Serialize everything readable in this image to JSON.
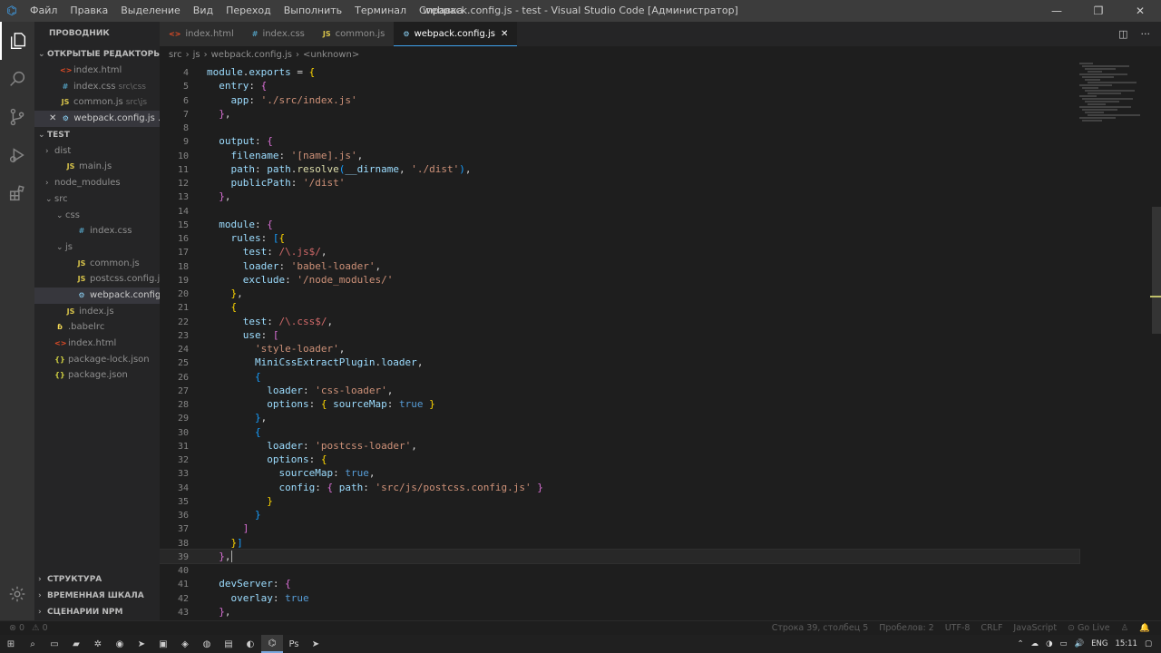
{
  "titlebar": {
    "logo_text": "⌬",
    "menu": [
      "Файл",
      "Правка",
      "Выделение",
      "Вид",
      "Переход",
      "Выполнить",
      "Терминал",
      "Справка"
    ],
    "window_title": "webpack.config.js - test - Visual Studio Code [Администратор]",
    "controls": [
      "—",
      "❐",
      "✕"
    ]
  },
  "sidebar": {
    "title": "ПРОВОДНИК",
    "open_editors_title": "ОТКРЫТЫЕ РЕДАКТОРЫ",
    "open_editors": [
      {
        "icon": "<>",
        "icon_class": "ic-html",
        "name": "index.html",
        "path": ""
      },
      {
        "icon": "#",
        "icon_class": "ic-css",
        "name": "index.css",
        "path": "src\\css"
      },
      {
        "icon": "JS",
        "icon_class": "ic-js",
        "name": "common.js",
        "path": "src\\js"
      },
      {
        "icon": "⚙",
        "icon_class": "ic-wp",
        "name": "webpack.config.js ...",
        "path": "",
        "close": "✕"
      }
    ],
    "project_title": "TEST",
    "tree": [
      {
        "indent": 1,
        "chev": "›",
        "icon": "",
        "icon_class": "",
        "name": "dist"
      },
      {
        "indent": 2,
        "chev": "",
        "icon": "JS",
        "icon_class": "ic-js",
        "name": "main.js"
      },
      {
        "indent": 1,
        "chev": "›",
        "icon": "",
        "icon_class": "",
        "name": "node_modules"
      },
      {
        "indent": 1,
        "chev": "⌄",
        "icon": "",
        "icon_class": "",
        "name": "src"
      },
      {
        "indent": 2,
        "chev": "⌄",
        "icon": "",
        "icon_class": "",
        "name": "css"
      },
      {
        "indent": 3,
        "chev": "",
        "icon": "#",
        "icon_class": "ic-css",
        "name": "index.css"
      },
      {
        "indent": 2,
        "chev": "⌄",
        "icon": "",
        "icon_class": "",
        "name": "js"
      },
      {
        "indent": 3,
        "chev": "",
        "icon": "JS",
        "icon_class": "ic-js",
        "name": "common.js"
      },
      {
        "indent": 3,
        "chev": "",
        "icon": "JS",
        "icon_class": "ic-js",
        "name": "postcss.config.js"
      },
      {
        "indent": 3,
        "chev": "",
        "icon": "⚙",
        "icon_class": "ic-wp",
        "name": "webpack.config.js",
        "selected": true
      },
      {
        "indent": 2,
        "chev": "",
        "icon": "JS",
        "icon_class": "ic-js",
        "name": "index.js"
      },
      {
        "indent": 1,
        "chev": "",
        "icon": "ɓ",
        "icon_class": "ic-babel",
        "name": ".babelrc"
      },
      {
        "indent": 1,
        "chev": "",
        "icon": "<>",
        "icon_class": "ic-html",
        "name": "index.html"
      },
      {
        "indent": 1,
        "chev": "",
        "icon": "{}",
        "icon_class": "ic-json",
        "name": "package-lock.json"
      },
      {
        "indent": 1,
        "chev": "",
        "icon": "{}",
        "icon_class": "ic-json",
        "name": "package.json"
      }
    ],
    "bottom_sections": [
      "СТРУКТУРА",
      "ВРЕМЕННАЯ ШКАЛА",
      "СЦЕНАРИИ NPM"
    ]
  },
  "tabs": [
    {
      "icon": "<>",
      "icon_class": "ic-html",
      "name": "index.html",
      "active": false
    },
    {
      "icon": "#",
      "icon_class": "ic-css",
      "name": "index.css",
      "active": false
    },
    {
      "icon": "JS",
      "icon_class": "ic-js",
      "name": "common.js",
      "active": false
    },
    {
      "icon": "⚙",
      "icon_class": "ic-wp",
      "name": "webpack.config.js",
      "active": true,
      "close": "✕"
    }
  ],
  "breadcrumb": {
    "items": [
      "src",
      "js",
      "webpack.config.js",
      "<unknown>"
    ],
    "separator": "›"
  },
  "editor": {
    "lines": [
      {
        "n": "4",
        "html": "<span class='k'>module</span><span class='p'>.</span><span class='k'>exports</span><span class='p'> = </span><span class='br1'>{</span>"
      },
      {
        "n": "5",
        "html": "  <span class='k'>entry</span><span class='p'>: </span><span class='br2'>{</span>"
      },
      {
        "n": "6",
        "html": "    <span class='k'>app</span><span class='p'>: </span><span class='s'>'./src/index.js'</span>"
      },
      {
        "n": "7",
        "html": "  <span class='br2'>}</span><span class='p'>,</span>"
      },
      {
        "n": "8",
        "html": ""
      },
      {
        "n": "9",
        "html": "  <span class='k'>output</span><span class='p'>: </span><span class='br2'>{</span>"
      },
      {
        "n": "10",
        "html": "    <span class='k'>filename</span><span class='p'>: </span><span class='s'>'[name].js'</span><span class='p'>,</span>"
      },
      {
        "n": "11",
        "html": "    <span class='k'>path</span><span class='p'>: </span><span class='k'>path</span><span class='p'>.</span><span class='f'>resolve</span><span class='br3'>(</span><span class='k'>__dirname</span><span class='p'>, </span><span class='s'>'./dist'</span><span class='br3'>)</span><span class='p'>,</span>"
      },
      {
        "n": "12",
        "html": "    <span class='k'>publicPath</span><span class='p'>: </span><span class='s'>'/dist'</span>"
      },
      {
        "n": "13",
        "html": "  <span class='br2'>}</span><span class='p'>,</span>"
      },
      {
        "n": "14",
        "html": ""
      },
      {
        "n": "15",
        "html": "  <span class='k'>module</span><span class='p'>: </span><span class='br2'>{</span>"
      },
      {
        "n": "16",
        "html": "    <span class='k'>rules</span><span class='p'>: </span><span class='br3'>[</span><span class='br1'>{</span>"
      },
      {
        "n": "17",
        "html": "      <span class='k'>test</span><span class='p'>: </span><span class='r'>/\\.js$/</span><span class='p'>,</span>"
      },
      {
        "n": "18",
        "html": "      <span class='k'>loader</span><span class='p'>: </span><span class='s'>'babel-loader'</span><span class='p'>,</span>"
      },
      {
        "n": "19",
        "html": "      <span class='k'>exclude</span><span class='p'>: </span><span class='s'>'/node_modules/'</span>"
      },
      {
        "n": "20",
        "html": "    <span class='br1'>}</span><span class='p'>,</span>"
      },
      {
        "n": "21",
        "html": "    <span class='br1'>{</span>"
      },
      {
        "n": "22",
        "html": "      <span class='k'>test</span><span class='p'>: </span><span class='r'>/\\.css$/</span><span class='p'>,</span>"
      },
      {
        "n": "23",
        "html": "      <span class='k'>use</span><span class='p'>: </span><span class='br2'>[</span>"
      },
      {
        "n": "24",
        "html": "        <span class='s'>'style-loader'</span><span class='p'>,</span>"
      },
      {
        "n": "25",
        "html": "        <span class='k'>MiniCssExtractPlugin</span><span class='p'>.</span><span class='k'>loader</span><span class='p'>,</span>"
      },
      {
        "n": "26",
        "html": "        <span class='br3'>{</span>"
      },
      {
        "n": "27",
        "html": "          <span class='k'>loader</span><span class='p'>: </span><span class='s'>'css-loader'</span><span class='p'>,</span>"
      },
      {
        "n": "28",
        "html": "          <span class='k'>options</span><span class='p'>: </span><span class='br1'>{</span><span class='p'> </span><span class='k'>sourceMap</span><span class='p'>: </span><span class='b'>true</span><span class='p'> </span><span class='br1'>}</span>"
      },
      {
        "n": "29",
        "html": "        <span class='br3'>}</span><span class='p'>,</span>"
      },
      {
        "n": "30",
        "html": "        <span class='br3'>{</span>"
      },
      {
        "n": "31",
        "html": "          <span class='k'>loader</span><span class='p'>: </span><span class='s'>'postcss-loader'</span><span class='p'>,</span>"
      },
      {
        "n": "32",
        "html": "          <span class='k'>options</span><span class='p'>: </span><span class='br1'>{</span>"
      },
      {
        "n": "33",
        "html": "            <span class='k'>sourceMap</span><span class='p'>: </span><span class='b'>true</span><span class='p'>,</span>"
      },
      {
        "n": "34",
        "html": "            <span class='k'>config</span><span class='p'>: </span><span class='br2'>{</span><span class='p'> </span><span class='k'>path</span><span class='p'>: </span><span class='s'>'src/js/postcss.config.js'</span><span class='p'> </span><span class='br2'>}</span>"
      },
      {
        "n": "35",
        "html": "          <span class='br1'>}</span>"
      },
      {
        "n": "36",
        "html": "        <span class='br3'>}</span>"
      },
      {
        "n": "37",
        "html": "      <span class='br2'>]</span>"
      },
      {
        "n": "38",
        "html": "    <span class='br1'>}</span><span class='br3'>]</span>"
      },
      {
        "n": "39",
        "html": "  <span class='br2'>}</span><span class='p'>,</span><span class='cursor'></span>",
        "current": true
      },
      {
        "n": "40",
        "html": ""
      },
      {
        "n": "41",
        "html": "  <span class='k'>devServer</span><span class='p'>: </span><span class='br2'>{</span>"
      },
      {
        "n": "42",
        "html": "    <span class='k'>overlay</span><span class='p'>: </span><span class='b'>true</span>"
      },
      {
        "n": "43",
        "html": "  <span class='br2'>}</span><span class='p'>,</span>"
      }
    ]
  },
  "statusbar": {
    "left": [
      "⊗ 0",
      "⚠ 0"
    ],
    "right": [
      "Строка 39, столбец 5",
      "Пробелов: 2",
      "UTF-8",
      "CRLF",
      "JavaScript",
      "⊙ Go Live",
      "♙",
      "🔔"
    ]
  },
  "taskbar": {
    "icons": [
      "⊞",
      "⌕",
      "▭",
      "▰",
      "✲",
      "◉",
      "➤",
      "▣",
      "◈",
      "◍",
      "▤",
      "◐",
      "⌬",
      "Ps",
      "➤"
    ],
    "active_index": 12,
    "tray": [
      "⌃",
      "☁",
      "◑",
      "▭",
      "🔊",
      "ENG",
      "15:11",
      "▢"
    ]
  }
}
